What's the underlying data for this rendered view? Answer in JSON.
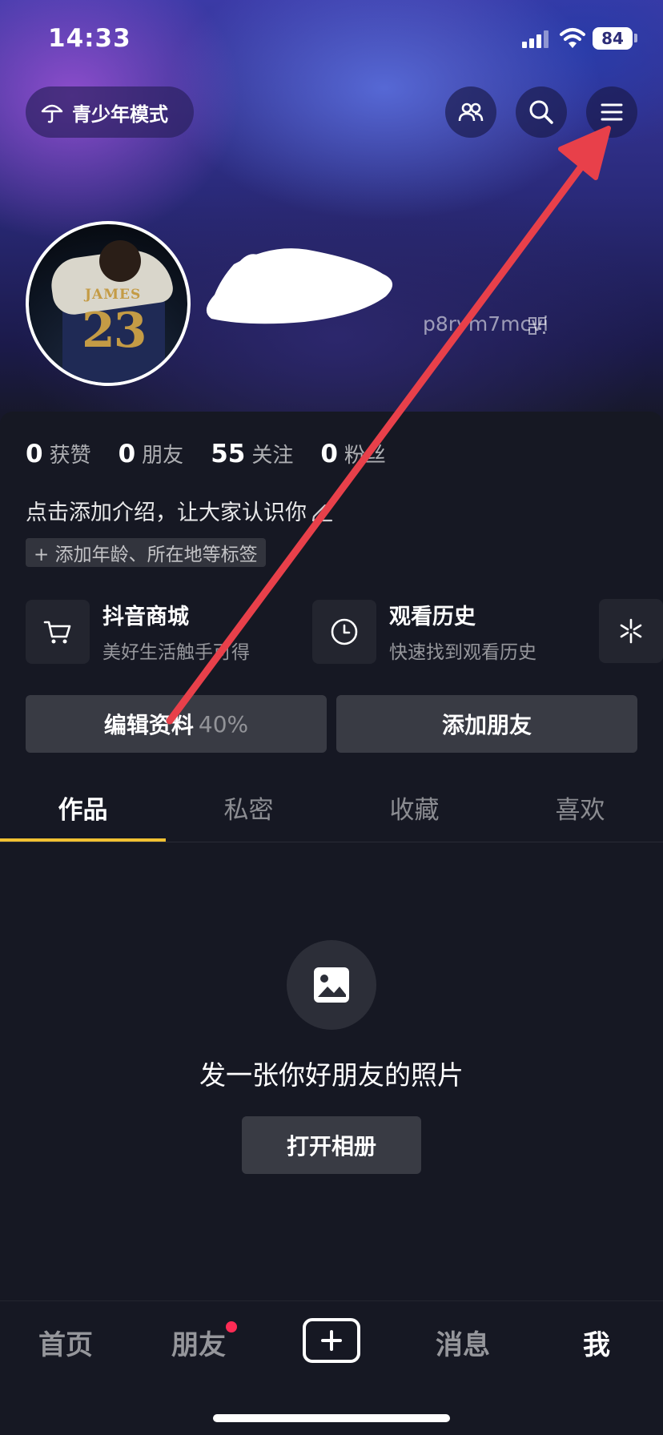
{
  "status_bar": {
    "time": "14:33",
    "battery": "84"
  },
  "header": {
    "teen_mode_label": "青少年模式"
  },
  "profile": {
    "account_id": "p8rvm7mcvi"
  },
  "stats": [
    {
      "value": "0",
      "label": "获赞"
    },
    {
      "value": "0",
      "label": "朋友"
    },
    {
      "value": "55",
      "label": "关注"
    },
    {
      "value": "0",
      "label": "粉丝"
    }
  ],
  "bio": {
    "placeholder": "点击添加介绍，让大家认识你",
    "tag_prompt": "+ 添加年龄、所在地等标签"
  },
  "features": [
    {
      "title": "抖音商城",
      "subtitle": "美好生活触手可得",
      "icon": "cart-icon"
    },
    {
      "title": "观看历史",
      "subtitle": "快速找到观看历史",
      "icon": "clock-icon"
    }
  ],
  "actions": {
    "edit_profile": "编辑资料",
    "edit_profile_progress": "40%",
    "add_friend": "添加朋友"
  },
  "tabs": [
    "作品",
    "私密",
    "收藏",
    "喜欢"
  ],
  "empty_state": {
    "message": "发一张你好朋友的照片",
    "button": "打开相册"
  },
  "bottom_nav": {
    "home": "首页",
    "friends": "朋友",
    "messages": "消息",
    "me": "我"
  },
  "avatar_jersey": {
    "name": "JAMES",
    "number": "23"
  },
  "colors": {
    "tab_indicator": "#f1c132",
    "notification_dot": "#fe2c55",
    "annotation_arrow": "#e8404a"
  }
}
